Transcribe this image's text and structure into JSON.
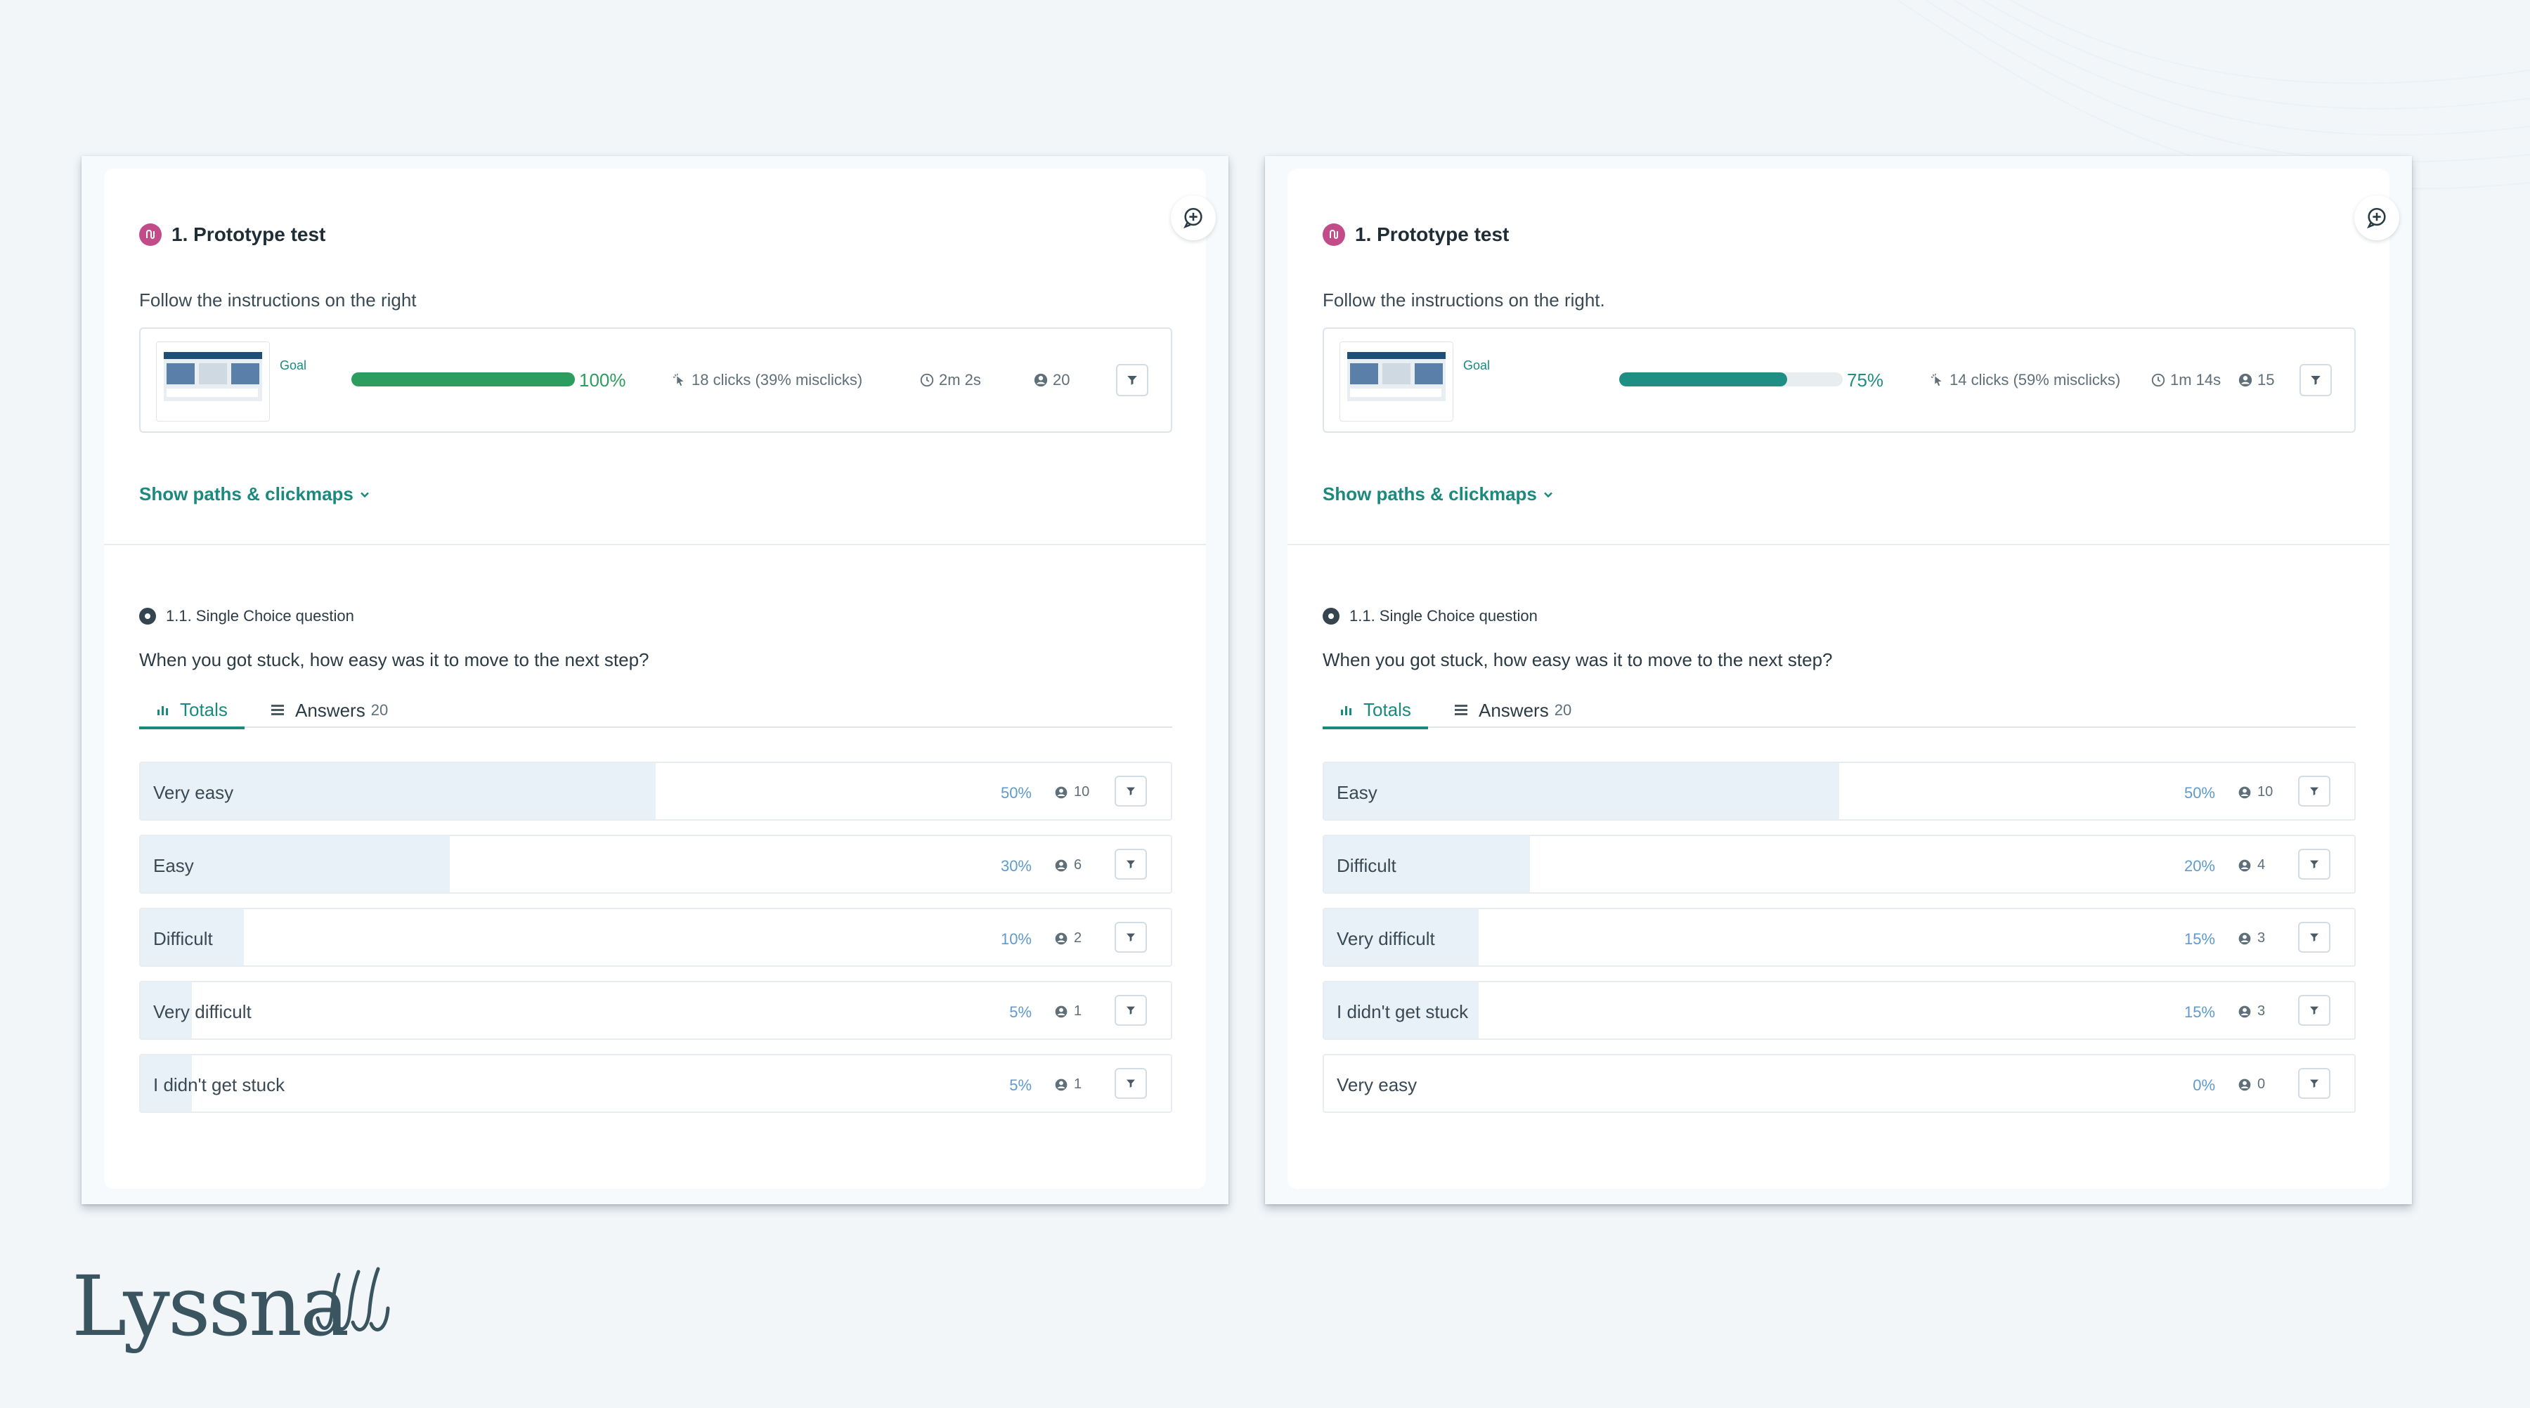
{
  "panels": [
    {
      "section_title": "1. Prototype test",
      "instructions": "Follow the instructions on the right",
      "goal_label": "Goal",
      "progress": {
        "percent": 100,
        "label": "100%",
        "color": "#2d9d5f"
      },
      "clicks": "18 clicks (39% misclicks)",
      "duration": "2m 2s",
      "participants": "20",
      "show_paths": "Show paths & clickmaps",
      "question_type": "1.1. Single Choice question",
      "question": "When you got stuck, how easy was it to move to the next step?",
      "tabs": {
        "totals": "Totals",
        "answers": "Answers",
        "answers_count": "20"
      },
      "answers": [
        {
          "label": "Very easy",
          "pct": "50%",
          "count": "10",
          "share": 50
        },
        {
          "label": "Easy",
          "pct": "30%",
          "count": "6",
          "share": 30
        },
        {
          "label": "Difficult",
          "pct": "10%",
          "count": "2",
          "share": 10
        },
        {
          "label": "Very difficult",
          "pct": "5%",
          "count": "1",
          "share": 5
        },
        {
          "label": "I didn't get stuck",
          "pct": "5%",
          "count": "1",
          "share": 5
        }
      ]
    },
    {
      "section_title": "1. Prototype test",
      "instructions": "Follow the instructions on the right.",
      "goal_label": "Goal",
      "progress": {
        "percent": 75,
        "label": "75%",
        "color": "#1f8f83"
      },
      "clicks": "14 clicks (59% misclicks)",
      "duration": "1m 14s",
      "participants": "15",
      "show_paths": "Show paths & clickmaps",
      "question_type": "1.1. Single Choice question",
      "question": "When you got stuck, how easy was it to move to the next step?",
      "tabs": {
        "totals": "Totals",
        "answers": "Answers",
        "answers_count": "20"
      },
      "answers": [
        {
          "label": "Easy",
          "pct": "50%",
          "count": "10",
          "share": 50
        },
        {
          "label": "Difficult",
          "pct": "20%",
          "count": "4",
          "share": 20
        },
        {
          "label": "Very difficult",
          "pct": "15%",
          "count": "3",
          "share": 15
        },
        {
          "label": "I didn't get stuck",
          "pct": "15%",
          "count": "3",
          "share": 15
        },
        {
          "label": "Very easy",
          "pct": "0%",
          "count": "0",
          "share": 0
        }
      ]
    }
  ],
  "brand": {
    "name": "Lyssna",
    "accent": "#1a8a7e",
    "logo_color": "#3b5560"
  }
}
